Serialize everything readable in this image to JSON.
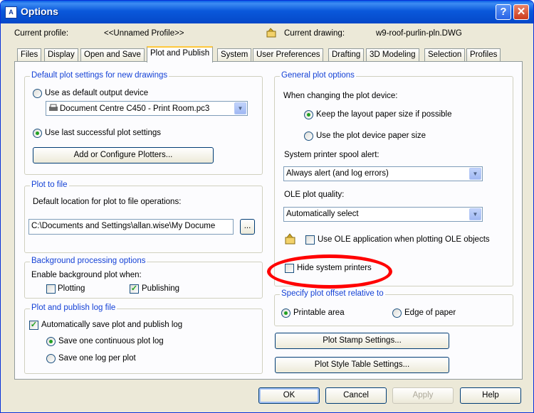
{
  "window": {
    "title": "Options",
    "icon_text": "A",
    "help_symbol": "?",
    "close_symbol": "✕"
  },
  "profile": {
    "current_profile_label": "Current profile:",
    "current_profile_value": "<<Unnamed Profile>>",
    "current_drawing_label": "Current drawing:",
    "current_drawing_value": "w9-roof-purlin-pln.DWG"
  },
  "tabs": [
    "Files",
    "Display",
    "Open and Save",
    "Plot and Publish",
    "System",
    "User Preferences",
    "Drafting",
    "3D Modeling",
    "Selection",
    "Profiles"
  ],
  "active_tab": "Plot and Publish",
  "default_plot": {
    "title": "Default plot settings for new drawings",
    "use_default_label": "Use as default output device",
    "device_value": "Document Centre C450 - Print Room.pc3",
    "use_last_label": "Use last successful plot settings",
    "add_plotters_label": "Add or Configure Plotters..."
  },
  "plot_to_file": {
    "title": "Plot to file",
    "location_label": "Default location for plot to file operations:",
    "location_value": "C:\\Documents and Settings\\allan.wise\\My Docume",
    "browse_label": "..."
  },
  "background": {
    "title": "Background processing options",
    "enable_label": "Enable background plot when:",
    "plotting_label": "Plotting",
    "publishing_label": "Publishing",
    "plotting_checked": false,
    "publishing_checked": true
  },
  "log_file": {
    "title": "Plot and publish log file",
    "auto_save_label": "Automatically save plot and publish log",
    "continuous_label": "Save one continuous plot log",
    "per_plot_label": "Save one log per plot"
  },
  "general": {
    "title": "General plot options",
    "changing_label": "When changing the plot device:",
    "keep_layout_label": "Keep the layout paper size if possible",
    "use_device_label": "Use the plot device paper size",
    "spool_label": "System printer spool alert:",
    "spool_value": "Always alert (and log errors)",
    "ole_quality_label": "OLE plot quality:",
    "ole_quality_value": "Automatically select",
    "use_ole_label": "Use OLE application when plotting OLE objects",
    "hide_printers_label": "Hide system printers"
  },
  "offset": {
    "title": "Specify plot offset relative to",
    "printable_label": "Printable area",
    "edge_label": "Edge of paper"
  },
  "buttons": {
    "plot_stamp": "Plot Stamp Settings...",
    "plot_style": "Plot Style Table Settings...",
    "ok": "OK",
    "cancel": "Cancel",
    "apply": "Apply",
    "help": "Help"
  },
  "colors": {
    "group_title": "#1542d6",
    "highlight": "#ff0000",
    "titlebar": "#0a58db"
  }
}
